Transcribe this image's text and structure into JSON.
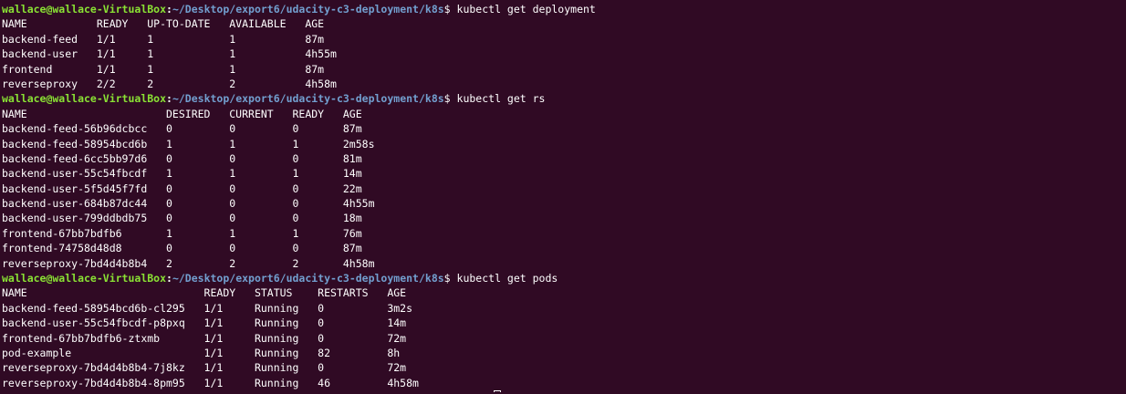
{
  "colors": {
    "background": "#300a24",
    "prompt_user": "#8ae234",
    "prompt_path": "#729fcf",
    "text": "#ffffff"
  },
  "prompt": {
    "user_host": "wallace@wallace-VirtualBox",
    "separator": ":",
    "suffix": "$ "
  },
  "blocks": [
    {
      "path": "~/Desktop/export6/udacity-c3-deployment/k8s",
      "command": "kubectl get deployment",
      "output": [
        "NAME           READY   UP-TO-DATE   AVAILABLE   AGE",
        "backend-feed   1/1     1            1           87m",
        "backend-user   1/1     1            1           4h55m",
        "frontend       1/1     1            1           87m",
        "reverseproxy   2/2     2            2           4h58m"
      ]
    },
    {
      "path": "~/Desktop/export6/udacity-c3-deployment/k8s",
      "command": "kubectl get rs",
      "output": [
        "NAME                      DESIRED   CURRENT   READY   AGE",
        "backend-feed-56b96dcbcc   0         0         0       87m",
        "backend-feed-58954bcd6b   1         1         1       2m58s",
        "backend-feed-6cc5bb97d6   0         0         0       81m",
        "backend-user-55c54fbcdf   1         1         1       14m",
        "backend-user-5f5d45f7fd   0         0         0       22m",
        "backend-user-684b87dc44   0         0         0       4h55m",
        "backend-user-799ddbdb75   0         0         0       18m",
        "frontend-67bb7bdfb6       1         1         1       76m",
        "frontend-74758d48d8       0         0         0       87m",
        "reverseproxy-7bd4d4b8b4   2         2         2       4h58m"
      ]
    },
    {
      "path": "~/Desktop/export6/udacity-c3-deployment/k8s",
      "command": "kubectl get pods",
      "output": [
        "NAME                            READY   STATUS    RESTARTS   AGE",
        "backend-feed-58954bcd6b-cl295   1/1     Running   0          3m2s",
        "backend-user-55c54fbcdf-p8pxq   1/1     Running   0          14m",
        "frontend-67bb7bdfb6-ztxmb       1/1     Running   0          72m",
        "pod-example                     1/1     Running   82         8h",
        "reverseproxy-7bd4d4b8b4-7j8kz   1/1     Running   0          72m",
        "reverseproxy-7bd4d4b8b4-8pm95   1/1     Running   46         4h58m"
      ]
    }
  ]
}
